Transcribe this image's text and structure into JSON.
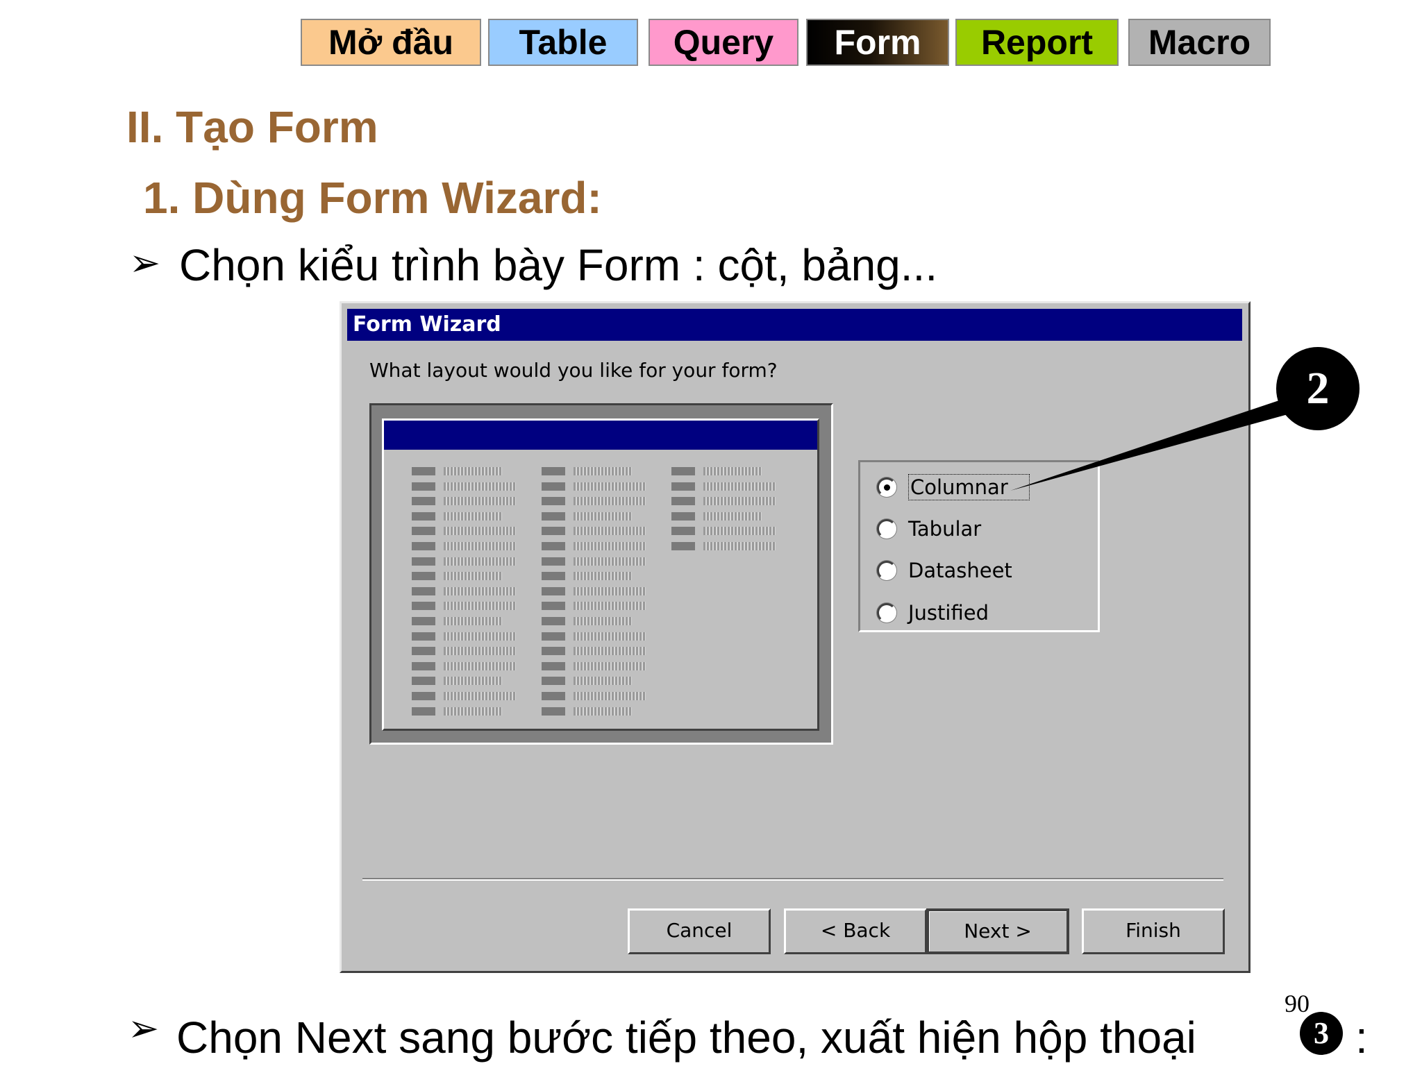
{
  "nav": {
    "tabs": [
      {
        "label": "Mở đầu",
        "color": "#fbc98e"
      },
      {
        "label": "Table",
        "color": "#99ccff"
      },
      {
        "label": "Query",
        "color": "#ff99cc"
      },
      {
        "label": "Form",
        "color": "#000000",
        "active": true
      },
      {
        "label": "Report",
        "color": "#99cc00"
      },
      {
        "label": "Macro",
        "color": "#b2b2b2"
      }
    ]
  },
  "slide": {
    "heading1": "II. Tạo Form",
    "heading2": "1. Dùng Form Wizard:",
    "bullet1": "Chọn kiểu trình bày Form : cột, bảng...",
    "bullet2": "Chọn Next sang bước tiếp theo, xuất hiện hộp thoại",
    "bullet_marker": "➢",
    "callout_step2": "2",
    "callout_step3": "3",
    "colon": ":",
    "page_number": "90",
    "heading_color": "#996633"
  },
  "dialog": {
    "title": "Form Wizard",
    "question": "What layout would you like for your form?",
    "options": [
      {
        "label": "Columnar",
        "selected": true
      },
      {
        "label": "Tabular",
        "selected": false
      },
      {
        "label": "Datasheet",
        "selected": false
      },
      {
        "label": "Justified",
        "selected": false
      }
    ],
    "buttons": {
      "cancel": "Cancel",
      "back": "< Back",
      "next": "Next >",
      "finish": "Finish"
    },
    "title_color": "#000080",
    "face_color": "#c0c0c0"
  }
}
